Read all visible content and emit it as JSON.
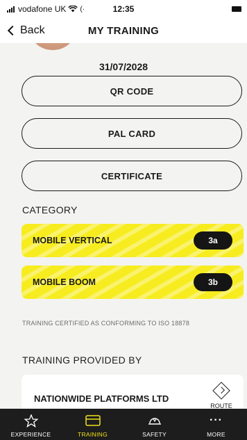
{
  "status_bar": {
    "carrier": "vodafone UK",
    "time": "12:35"
  },
  "nav": {
    "back_label": "Back",
    "title": "MY TRAINING"
  },
  "card": {
    "expiry_date": "31/07/2028"
  },
  "buttons": {
    "qr_code": "QR CODE",
    "pal_card": "PAL CARD",
    "certificate": "CERTIFICATE"
  },
  "category": {
    "heading": "CATEGORY",
    "items": [
      {
        "name": "MOBILE VERTICAL",
        "code": "3a"
      },
      {
        "name": "MOBILE BOOM",
        "code": "3b"
      }
    ],
    "iso_note": "TRAINING CERTIFIED AS CONFORMING TO ISO 18878"
  },
  "provider": {
    "heading": "TRAINING PROVIDED BY",
    "name": "NATIONWIDE PLATFORMS LTD",
    "route_label": "ROUTE"
  },
  "tabs": [
    {
      "label": "EXPERIENCE",
      "icon": "star-icon",
      "active": false
    },
    {
      "label": "TRAINING",
      "icon": "card-icon",
      "active": true
    },
    {
      "label": "SAFETY",
      "icon": "helmet-icon",
      "active": false
    },
    {
      "label": "MORE",
      "icon": "more-dots-icon",
      "active": false
    }
  ],
  "colors": {
    "accent_yellow": "#f7ec1f",
    "tab_bar": "#1d1d1d",
    "active_tab": "#f0e21a"
  }
}
